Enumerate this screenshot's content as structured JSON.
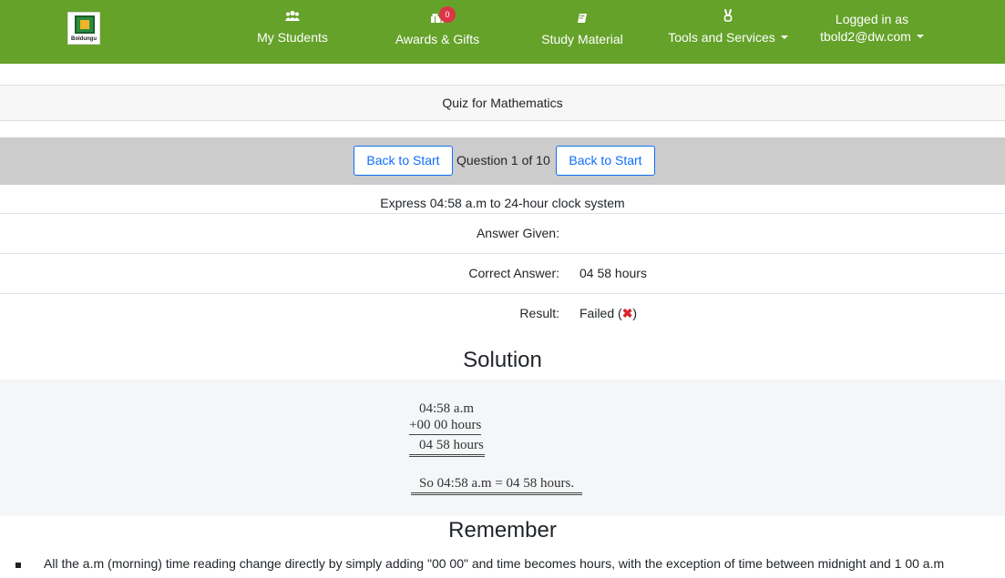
{
  "brand": {
    "logo_text": "Boldungu"
  },
  "nav": {
    "students": {
      "label": "My Students",
      "icon": "users-icon"
    },
    "awards": {
      "label": "Awards & Gifts",
      "icon": "gifts-icon",
      "badge": "0"
    },
    "study": {
      "label": "Study Material",
      "icon": "book-icon"
    },
    "tools": {
      "label": "Tools and Services",
      "icon": "hand-peace-icon"
    },
    "user": {
      "line1": "Logged in as",
      "email": "tbold2@dw.com"
    }
  },
  "quiz": {
    "title": "Quiz for Mathematics"
  },
  "question_nav": {
    "back_left": "Back to Start",
    "counter": "Question 1 of 10",
    "back_right": "Back to Start"
  },
  "question": {
    "text": "Express 04:58 a.m to 24-hour clock system",
    "answer_label": "Answer Given:",
    "answer_value": "",
    "correct_label": "Correct Answer:",
    "correct_value": "04 58 hours",
    "result_label": "Result:",
    "result_value": "Failed (",
    "result_mark": "✖",
    "result_close": ")"
  },
  "solution": {
    "heading": "Solution",
    "line1": "04:58 a.m",
    "line2": "+00 00 hours",
    "line3": "04 58 hours",
    "line4": "So 04:58 a.m = 04 58 hours."
  },
  "remember": {
    "heading": "Remember",
    "items": [
      "All the a.m (morning) time reading change directly by simply adding \"00 00\" and time becomes hours, with the exception of time between midnight and 1 00 a.m"
    ]
  },
  "colors": {
    "navbar": "#65a22a",
    "link_blue": "#0d6efd",
    "nav_bar_gray": "#cccccc",
    "badge_red": "#dc3545",
    "fail_red": "#d9262c"
  }
}
